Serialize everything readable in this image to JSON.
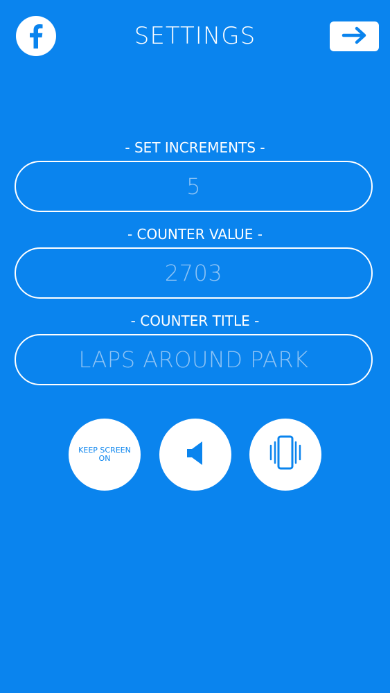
{
  "header": {
    "title": "SETTINGS",
    "facebook_icon": "facebook-icon",
    "next_icon": "arrow-right-icon"
  },
  "fields": [
    {
      "label": "- SET INCREMENTS -",
      "value": "5"
    },
    {
      "label": "- COUNTER VALUE -",
      "value": "2703"
    },
    {
      "label": "- COUNTER TITLE -",
      "value": "LAPS AROUND PARK"
    }
  ],
  "toggles": {
    "keep_screen_on_label": "KEEP SCREEN ON",
    "sound_icon": "speaker-icon",
    "vibrate_icon": "vibrate-phone-icon"
  },
  "colors": {
    "background": "#0A84EE",
    "foreground": "#FFFFFF",
    "value_text": "#8FC4F5"
  }
}
